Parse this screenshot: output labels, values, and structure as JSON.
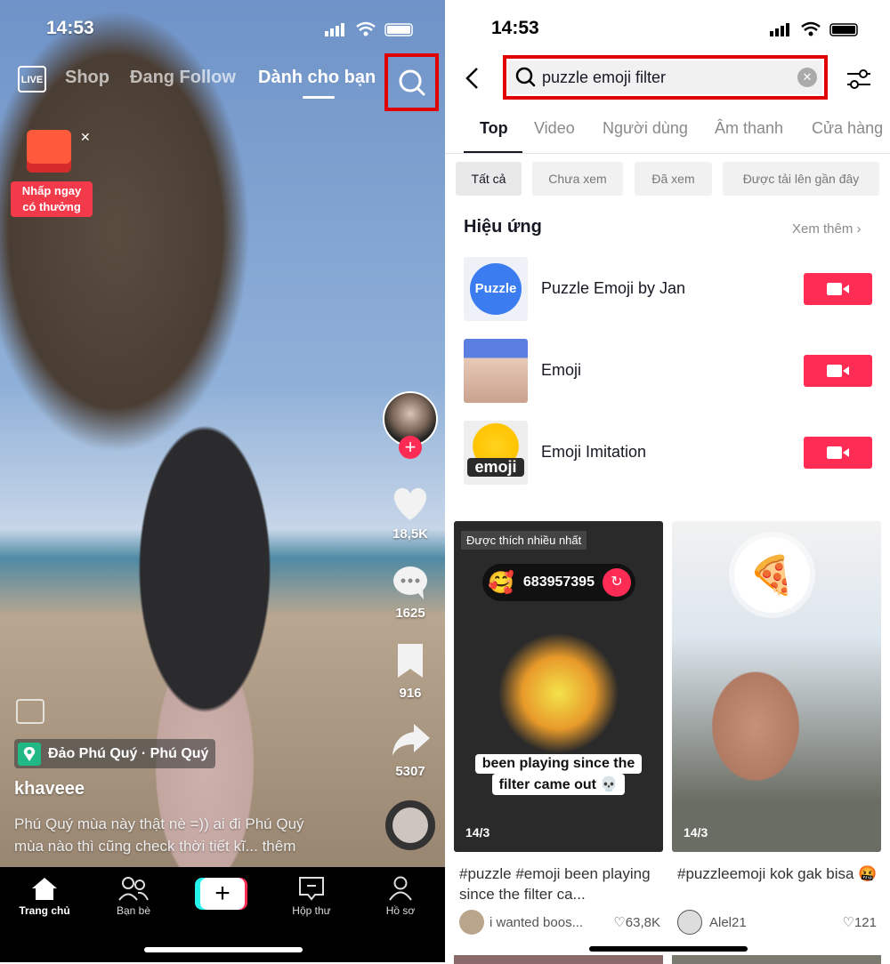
{
  "left": {
    "status_time": "14:53",
    "top_nav": {
      "live": "LIVE",
      "shop": "Shop",
      "following": "Đang Follow",
      "for_you": "Dành cho bạn"
    },
    "promo": {
      "line1": "Nhấp ngay",
      "line2": "có thưởng"
    },
    "rail": {
      "likes": "18,5K",
      "comments": "1625",
      "saves": "916",
      "shares": "5307"
    },
    "location": "Đảo Phú Quý · Phú Quý",
    "username": "khaveee",
    "description_line1": "Phú Quý mùa này thật nè =)) ai đi Phú Quý",
    "description_line2": "mùa nào thì cũng check thời tiết kĩ... thêm",
    "bottom_nav": [
      {
        "label": "Trang chủ",
        "icon": "home-icon"
      },
      {
        "label": "Bạn bè",
        "icon": "friends-icon"
      },
      {
        "label": "",
        "icon": "plus-icon"
      },
      {
        "label": "Hộp thư",
        "icon": "inbox-icon"
      },
      {
        "label": "Hồ sơ",
        "icon": "profile-icon"
      }
    ],
    "highlight_color": "#e00000"
  },
  "right": {
    "status_time": "14:53",
    "search": {
      "value": "puzzle emoji filter"
    },
    "tabs": [
      "Top",
      "Video",
      "Người dùng",
      "Âm thanh",
      "Cửa hàng"
    ],
    "active_tab": "Top",
    "chips": [
      "Tất cả",
      "Chưa xem",
      "Đã xem",
      "Được tải lên gần đây"
    ],
    "effects_section": {
      "title": "Hiệu ứng",
      "more": "Xem thêm"
    },
    "effects": [
      {
        "name": "Puzzle Emoji by Jan",
        "thumb_text": "Puzzle"
      },
      {
        "name": "Emoji"
      },
      {
        "name": "Emoji Imitation",
        "thumb_text": "emoji"
      }
    ],
    "accent": "#fe2c55",
    "videos": [
      {
        "badge": "Được thích nhiều nhất",
        "counter": "683957395",
        "overlay_line1": "been playing since the",
        "overlay_line2": "filter came out 💀",
        "date": "14/3",
        "caption": "#puzzle #emoji been playing since the filter ca...",
        "user": "i wanted boos...",
        "likes": "63,8K"
      },
      {
        "date": "14/3",
        "caption": "#puzzleemoji kok gak bisa 🤬",
        "user": "Alel21",
        "likes": "121"
      }
    ]
  }
}
